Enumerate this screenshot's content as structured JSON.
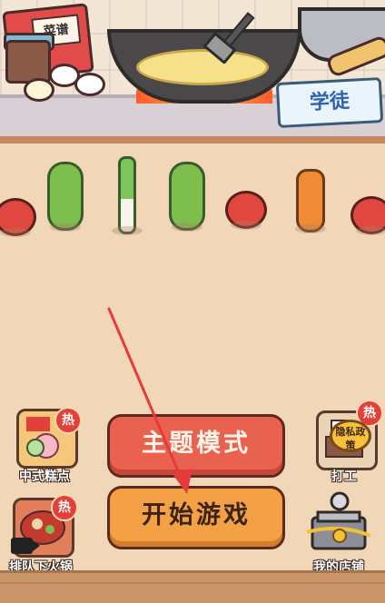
{
  "kitchen": {
    "recipe_book_label": "菜谱",
    "rank_sign": "学徒"
  },
  "vegetables": [
    "tomato",
    "cucumber",
    "scallion",
    "cucumber",
    "tomato",
    "carrot",
    "tomato"
  ],
  "left_menu": [
    {
      "label": "中式糕点",
      "badge": "热",
      "icon": "pastry-icon"
    },
    {
      "label": "排队下火锅",
      "badge": "热",
      "icon": "hotpot-icon"
    }
  ],
  "right_menu": [
    {
      "label": "打工",
      "badge": "热",
      "icon": "work-icon",
      "privacy": "隐私政策"
    },
    {
      "label": "我的店铺",
      "icon": "shop-icon"
    }
  ],
  "buttons": {
    "theme_mode": "主题模式",
    "start_game": "开始游戏"
  },
  "colors": {
    "theme_button": "#e8624f",
    "start_button": "#f4a045",
    "hot_badge": "#e2403a"
  }
}
